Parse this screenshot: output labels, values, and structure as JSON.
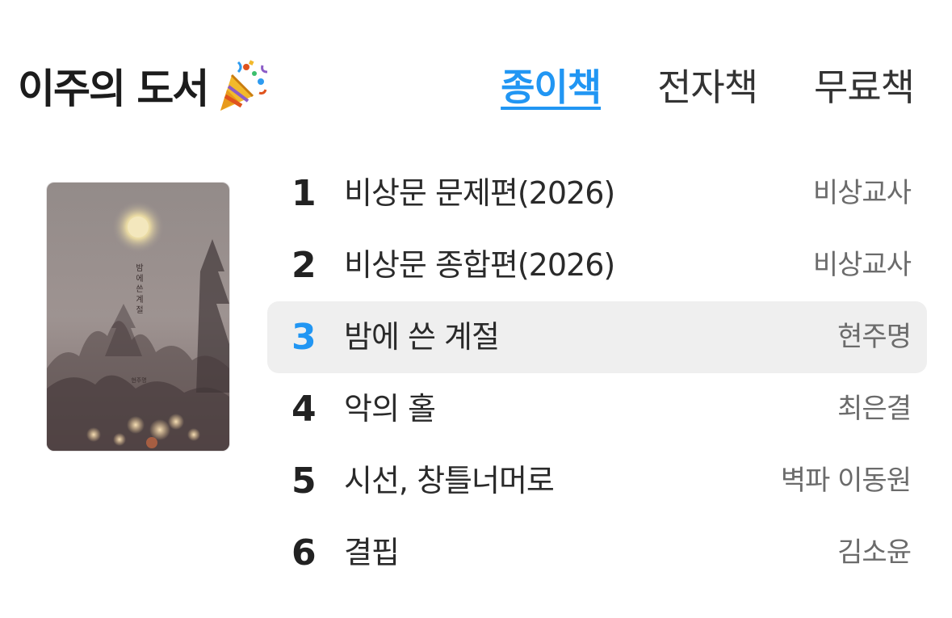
{
  "header": {
    "title": "이주의 도서",
    "title_icon": "party-popper-icon"
  },
  "tabs": [
    {
      "label": "종이책",
      "active": true
    },
    {
      "label": "전자책",
      "active": false
    },
    {
      "label": "무료책",
      "active": false
    }
  ],
  "featured_cover": {
    "title_vertical": "밤에 쓴 계절",
    "author_small": "현주명"
  },
  "books": [
    {
      "rank": "1",
      "title": "비상문 문제편(2026)",
      "author": "비상교사",
      "selected": false
    },
    {
      "rank": "2",
      "title": "비상문 종합편(2026)",
      "author": "비상교사",
      "selected": false
    },
    {
      "rank": "3",
      "title": "밤에 쓴 계절",
      "author": "현주명",
      "selected": true
    },
    {
      "rank": "4",
      "title": "악의 홀",
      "author": "최은결",
      "selected": false
    },
    {
      "rank": "5",
      "title": "시선, 창틀너머로",
      "author": "벽파 이동원",
      "selected": false
    },
    {
      "rank": "6",
      "title": "결핍",
      "author": "김소윤",
      "selected": false
    }
  ],
  "colors": {
    "accent": "#2196f3",
    "selected_row_bg": "#efefef",
    "author_text": "#6b6b6b"
  }
}
